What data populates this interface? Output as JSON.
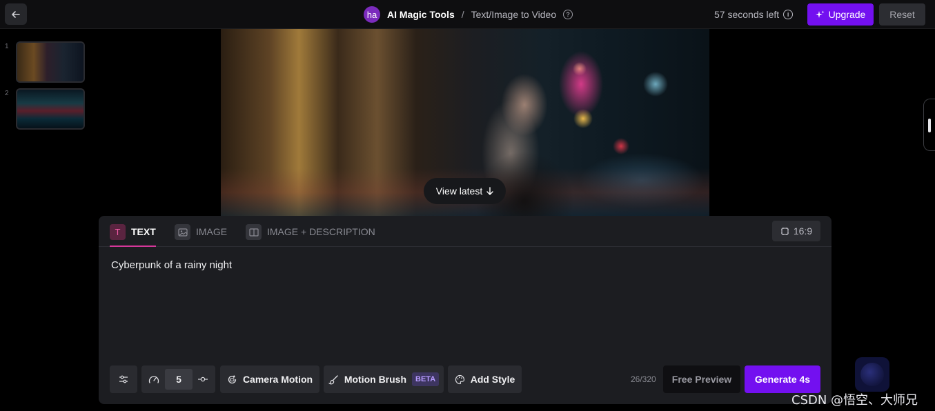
{
  "header": {
    "avatar_initials": "ha",
    "brand": "AI Magic Tools",
    "separator": "/",
    "page": "Text/Image to Video",
    "time_left": "57 seconds left",
    "upgrade_label": "Upgrade",
    "reset_label": "Reset"
  },
  "thumbnails": [
    {
      "index": "1"
    },
    {
      "index": "2"
    }
  ],
  "viewer": {
    "view_latest_label": "View latest"
  },
  "tabs": [
    {
      "label": "TEXT",
      "icon": "T",
      "active": true
    },
    {
      "label": "IMAGE",
      "icon": "image-icon",
      "active": false
    },
    {
      "label": "IMAGE + DESCRIPTION",
      "icon": "split-icon",
      "active": false
    }
  ],
  "aspect_ratio": "16:9",
  "prompt": {
    "value": "Cyberpunk of a rainy night"
  },
  "toolbar": {
    "speed_value": "5",
    "camera_motion_label": "Camera Motion",
    "motion_brush_label": "Motion Brush",
    "beta_badge": "BETA",
    "add_style_label": "Add Style",
    "char_count": "26/320",
    "free_preview_label": "Free Preview",
    "generate_label": "Generate 4s"
  },
  "watermark": "CSDN @悟空、大师兄",
  "colors": {
    "accent_purple": "#7310f0",
    "active_tab_pink": "#d6379a",
    "panel_bg": "#1c1d21"
  }
}
